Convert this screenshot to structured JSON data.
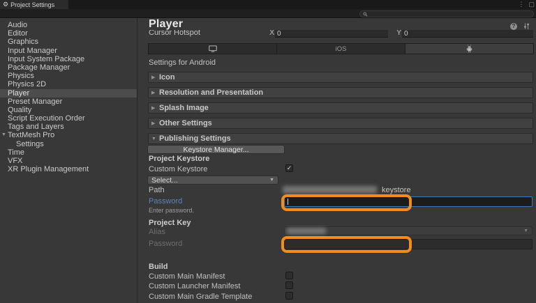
{
  "window": {
    "tab_title": "Project Settings",
    "gear_glyph": "⚙",
    "more_glyph": "⋮",
    "square_glyph": "▢"
  },
  "toolbar": {
    "search_placeholder": ""
  },
  "sidebar": {
    "items": [
      {
        "label": "Audio"
      },
      {
        "label": "Editor"
      },
      {
        "label": "Graphics"
      },
      {
        "label": "Input Manager"
      },
      {
        "label": "Input System Package"
      },
      {
        "label": "Package Manager"
      },
      {
        "label": "Physics"
      },
      {
        "label": "Physics 2D"
      },
      {
        "label": "Player",
        "selected": true
      },
      {
        "label": "Preset Manager"
      },
      {
        "label": "Quality"
      },
      {
        "label": "Script Execution Order"
      },
      {
        "label": "Tags and Layers"
      },
      {
        "label": "TextMesh Pro",
        "expanded": true
      },
      {
        "label": "Settings",
        "indent": true
      },
      {
        "label": "Time"
      },
      {
        "label": "VFX"
      },
      {
        "label": "XR Plugin Management"
      }
    ]
  },
  "header": {
    "title": "Player",
    "help_glyph": "?"
  },
  "inspector": {
    "cursor_hotspot": {
      "label": "Cursor Hotspot",
      "x_label": "X",
      "x_value": "0",
      "y_label": "Y",
      "y_value": "0"
    },
    "platform_tabs": {
      "tab1_icon": "standalone-monitor",
      "tab2_label": "iOS",
      "tab3_icon": "android-robot",
      "selected": "android"
    },
    "settings_for": "Settings for Android",
    "sections": [
      {
        "label": "Icon",
        "expanded": false
      },
      {
        "label": "Resolution and Presentation",
        "expanded": false
      },
      {
        "label": "Splash Image",
        "expanded": false
      },
      {
        "label": "Other Settings",
        "expanded": false
      },
      {
        "label": "Publishing Settings",
        "expanded": true
      }
    ],
    "publishing": {
      "keystore_manager_button": "Keystore Manager...",
      "project_keystore_header": "Project Keystore",
      "custom_keystore_label": "Custom Keystore",
      "custom_keystore_checked": true,
      "select_dropdown_value": "Select...",
      "path_label": "Path",
      "path_value_visible": "keystore",
      "password_label": "Password",
      "password_value": "",
      "password_helper": "Enter password.",
      "project_key_header": "Project Key",
      "alias_label": "Alias",
      "key_password_label": "Password",
      "key_password_value": "",
      "build_header": "Build",
      "build_options": [
        {
          "label": "Custom Main Manifest",
          "checked": false
        },
        {
          "label": "Custom Launcher Manifest",
          "checked": false
        },
        {
          "label": "Custom Main Gradle Template",
          "checked": false
        }
      ]
    }
  },
  "icons": {
    "check": "✓",
    "dropdown_arrow": "▼",
    "foldout_collapsed": "▶",
    "foldout_expanded": "▼"
  },
  "colors": {
    "highlight_orange": "#F28C1B",
    "focus_blue": "#3A79BB",
    "selection_gray": "#4C4C4C",
    "password_label_blue": "#5B83B9",
    "background": "#383838"
  }
}
